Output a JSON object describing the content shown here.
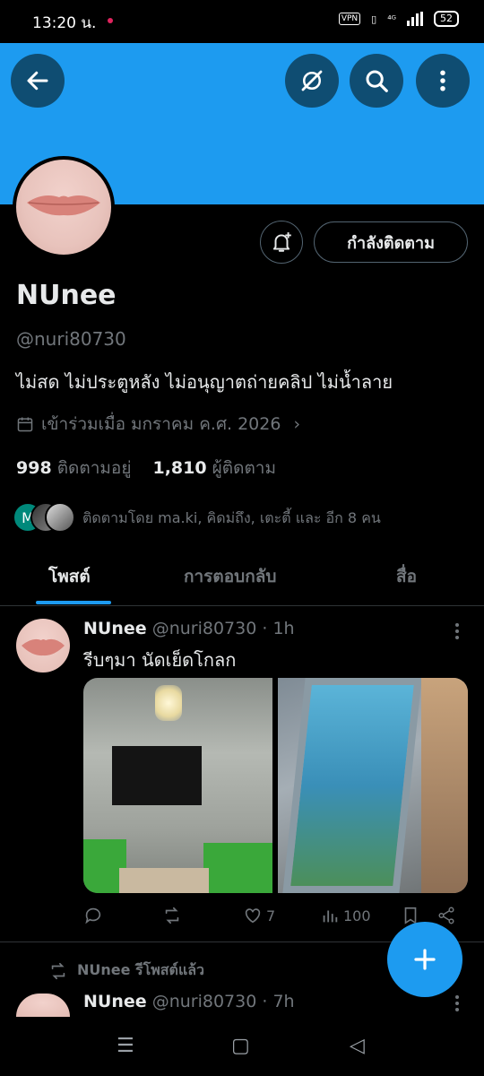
{
  "status_bar": {
    "time": "13:20 น.",
    "vpn": "VPN",
    "network": "⁴ᴳ",
    "battery": "52"
  },
  "header": {
    "back_icon": "arrow-left-icon",
    "grok_icon": "grok-icon",
    "search_icon": "search-icon",
    "more_icon": "more-vertical-icon"
  },
  "profile": {
    "display_name": "NUnee",
    "handle": "@nuri80730",
    "bio": "ไม่สด ไม่ประตูหลัง ไม่อนุญาตถ่ายคลิป ไม่น้ำลาย",
    "joined": "เข้าร่วมเมื่อ มกราคม ค.ศ. 2026",
    "following_count": "998",
    "following_label": "ติดตามอยู่",
    "followers_count": "1,810",
    "followers_label": "ผู้ติดตาม",
    "followed_by": "ติดตามโดย ma.ki, คิดม่ถึง, เตะตี้ และ อีก 8 คน",
    "followed_by_initial": "M",
    "following_button": "กำลังติดตาม"
  },
  "tabs": [
    {
      "label": "โพสต์",
      "active": true
    },
    {
      "label": "การตอบกลับ",
      "active": false
    },
    {
      "label": "สื่อ",
      "active": false
    }
  ],
  "post1": {
    "name": "NUnee",
    "handle": "@nuri80730",
    "time": "· 1h",
    "text": "รีบๆมา นัดเย็ดโกลก",
    "likes": "7",
    "views": "100"
  },
  "post2": {
    "repost_label": "NUnee รีโพสต์แล้ว",
    "name": "NUnee",
    "handle": "@nuri80730",
    "time": "· 7h"
  },
  "colors": {
    "accent": "#1d9bf0",
    "banner": "#1d9bf0",
    "background": "#000000"
  }
}
